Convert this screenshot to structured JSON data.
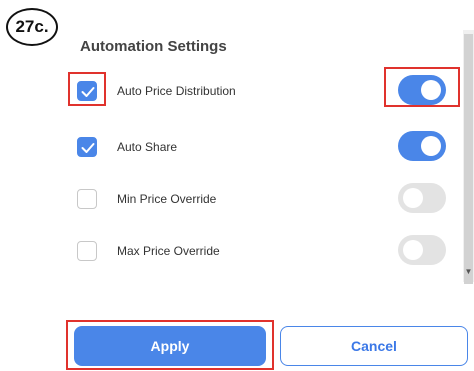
{
  "step_badge": "27c.",
  "section_title": "Automation Settings",
  "settings": [
    {
      "label": "Auto Price Distribution",
      "checked": true,
      "toggle_on": true
    },
    {
      "label": "Auto Share",
      "checked": true,
      "toggle_on": true
    },
    {
      "label": "Min Price Override",
      "checked": false,
      "toggle_on": false
    },
    {
      "label": "Max Price Override",
      "checked": false,
      "toggle_on": false
    }
  ],
  "buttons": {
    "apply_label": "Apply",
    "cancel_label": "Cancel"
  },
  "colors": {
    "accent": "#4a86e8",
    "highlight": "#e0322d",
    "toggle_off": "#e3e3e3"
  }
}
